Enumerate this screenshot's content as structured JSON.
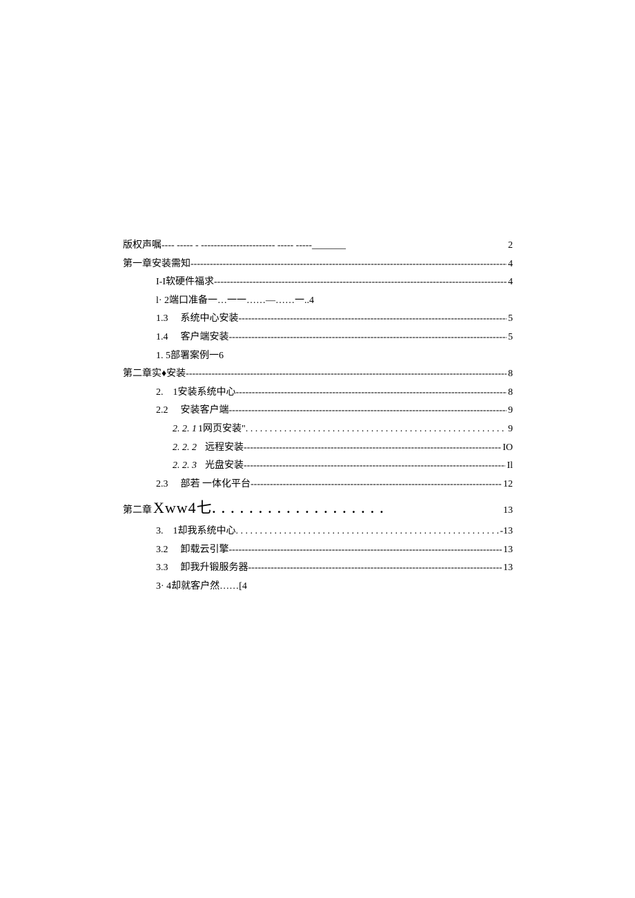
{
  "toc": {
    "copyright": {
      "title": "版权声嘱",
      "page": "2"
    },
    "ch1": {
      "title": "第一章安装需知",
      "page": "4"
    },
    "s1_1": {
      "title": "I-I软硬件福求",
      "page": "4"
    },
    "s1_2": {
      "title": "l· 2端口准备一…一一……—……一..4"
    },
    "s1_3": {
      "num": "1.3",
      "title": "系统中心安装",
      "page": "5"
    },
    "s1_4": {
      "num": "1.4",
      "title": "客户端安装",
      "page": "5"
    },
    "s1_5": {
      "title": "1.  5部署案例一6"
    },
    "ch2": {
      "title": "第二章实♦安装",
      "page": "8"
    },
    "s2_1": {
      "num": "2.",
      "title": "1安装系统中心",
      "page": "8"
    },
    "s2_2": {
      "num": "2.2",
      "title": "安装客户端",
      "page": "9"
    },
    "s2_2_1": {
      "num": "2. 2. 1",
      "title": "1网页安装\"",
      "page": "9"
    },
    "s2_2_2": {
      "num": "2. 2. 2",
      "title": "远程安装",
      "page": "IO"
    },
    "s2_2_3": {
      "num": "2. 2. 3",
      "title": "光盘安装",
      "page": "Il"
    },
    "s2_3": {
      "num": "2.3",
      "title": "部若 一体化平台",
      "page": "12"
    },
    "ch3": {
      "title_a": "第二章",
      "title_b": "Xww4七",
      "page": "13"
    },
    "s3_1": {
      "num": "3.",
      "title": "1却我系统中心",
      "page": "-13"
    },
    "s3_2": {
      "num": "3.2",
      "title": "卸载云引擎",
      "page": "13"
    },
    "s3_3": {
      "num": "3.3",
      "title": "卸我升锻服务器",
      "page": "13"
    },
    "s3_4": {
      "title": "3· 4却就客户然……[4"
    }
  }
}
